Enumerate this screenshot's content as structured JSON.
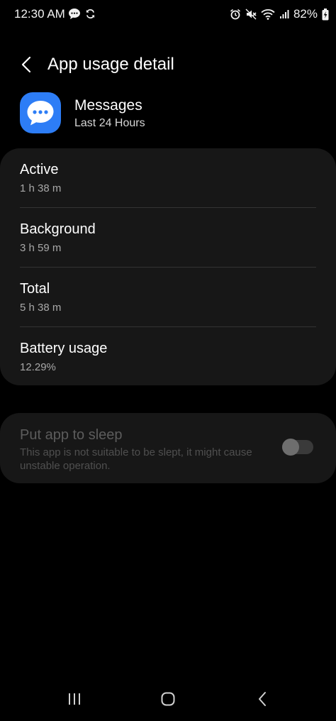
{
  "status_bar": {
    "time": "12:30 AM",
    "battery_percent": "82%",
    "left_icons": [
      "chat-bubble-icon",
      "sync-icon"
    ],
    "right_icons": [
      "alarm-icon",
      "mute-icon",
      "wifi-icon",
      "signal-icon",
      "battery-charging-icon"
    ]
  },
  "header": {
    "title": "App usage detail",
    "back_icon": "chevron-left-icon"
  },
  "app": {
    "name": "Messages",
    "period": "Last 24 Hours",
    "icon": "messages-app-icon",
    "icon_color": "#2d7df6"
  },
  "stats": [
    {
      "label": "Active",
      "value": "1 h 38 m"
    },
    {
      "label": "Background",
      "value": "3 h 59 m"
    },
    {
      "label": "Total",
      "value": "5 h 38 m"
    },
    {
      "label": "Battery usage",
      "value": "12.29%"
    }
  ],
  "sleep": {
    "title": "Put app to sleep",
    "description": "This app is not suitable to be slept, it might cause unstable operation.",
    "toggle_on": false,
    "enabled": false
  },
  "nav_bar": {
    "buttons": [
      "recents-icon",
      "home-icon",
      "back-icon"
    ]
  }
}
